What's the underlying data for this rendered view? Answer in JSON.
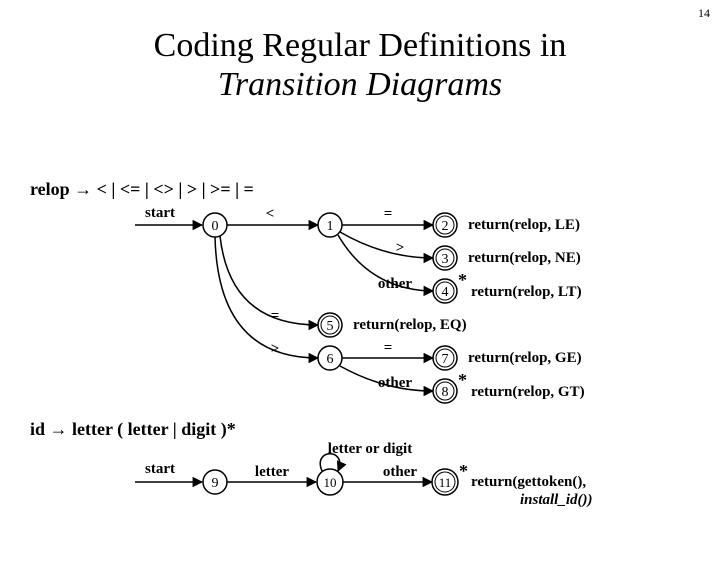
{
  "page_number": "14",
  "title_line1": "Coding Regular Definitions in",
  "title_line2": "Transition Diagrams",
  "relop_def": "relop → < | <= | <> | > | >= | =",
  "id_def": "id → letter ( letter | digit )*",
  "start_label": "start",
  "edges": {
    "lt": "<",
    "eq": "=",
    "gt": ">",
    "other": "other",
    "letter": "letter",
    "letter_or_digit": "letter or digit"
  },
  "nodes": {
    "n0": "0",
    "n1": "1",
    "n2": "2",
    "n3": "3",
    "n4": "4",
    "n5": "5",
    "n6": "6",
    "n7": "7",
    "n8": "8",
    "n9": "9",
    "n10": "10",
    "n11": "11"
  },
  "returns": {
    "r2": "return(relop, LE)",
    "r3": "return(relop, NE)",
    "r4": "return(relop, LT)",
    "r5": "return(relop, EQ)",
    "r7": "return(relop, GE)",
    "r8": "return(relop, GT)",
    "r11a": "return(gettoken(),",
    "r11b": "install_id())"
  }
}
